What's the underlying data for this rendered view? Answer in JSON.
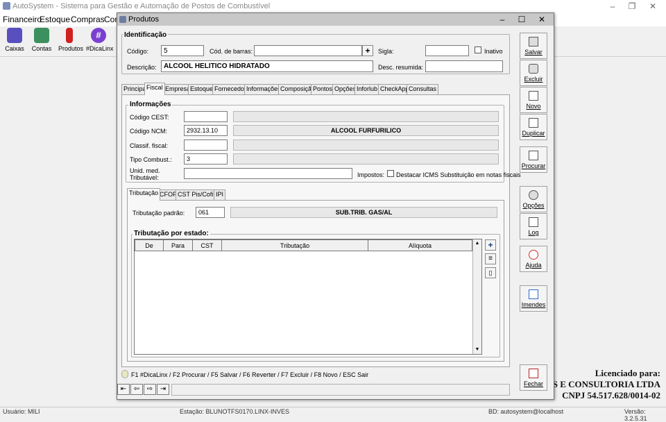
{
  "app": {
    "title": "AutoSystem - Sistema para Gestão e Automação de Postos de Combustível",
    "controls": [
      "–",
      "❐",
      "✕"
    ]
  },
  "menu": {
    "items": [
      "Financeiro",
      "Estoque",
      "Compras",
      "Con"
    ]
  },
  "toolbar": {
    "buttons": [
      {
        "label": "Caixas",
        "color": "#5a4fbf"
      },
      {
        "label": "Contas",
        "color": "#3c8f5e"
      },
      {
        "label": "Produtos",
        "color": "#d02020"
      },
      {
        "label": "#DicaLinx",
        "color": "#7a3fd0"
      }
    ]
  },
  "license": {
    "line1": "Licenciado para:",
    "line2": "MAS E CONSULTORIA LTDA",
    "line3": "CNPJ 54.517.628/0014-02"
  },
  "status": {
    "user": "Usuário: MILI",
    "station": "Estação: BLUNOTFS0170.LINX-INVES",
    "db": "BD: autosystem@localhost",
    "version": "Versão: 3.2.5.31"
  },
  "dialog": {
    "title": "Produtos",
    "controls": [
      "–",
      "☐",
      "✕"
    ],
    "identificacao": {
      "title": "Identificação",
      "codigo_label": "Código:",
      "codigo_value": "5",
      "barras_label": "Cód. de barras:",
      "barras_value": "",
      "sigla_label": "Sigla:",
      "sigla_value": "",
      "inativo_label": "Inativo",
      "descricao_label": "Descrição:",
      "descricao_value": "ALCOOL HELITICO HIDRATADO",
      "desc_resumida_label": "Desc. resumida:",
      "desc_resumida_value": ""
    },
    "tabs": [
      "Principal",
      "Fiscal",
      "Empresa",
      "Estoque",
      "Fornecedor",
      "Informações",
      "Composição",
      "Pontos",
      "Opções",
      "Inforlub",
      "CheckApp",
      "Consultas"
    ],
    "informacoes": {
      "title": "Informações",
      "cest_label": "Código CEST:",
      "cest_value": "",
      "ncm_label": "Código NCM:",
      "ncm_value": "2932.13.10",
      "ncm_desc": "ALCOOL FURFURILICO",
      "classif_label": "Classif. fiscal:",
      "classif_value": "",
      "tipo_label": "Tipo Combust.:",
      "tipo_value": "3",
      "unid_label": "Unid. med. Tributável:",
      "unid_value": "",
      "impostos_label": "Impostos:",
      "destacar_label": "Destacar ICMS Substituição em notas fiscais"
    },
    "subtabs": [
      "Tributação",
      "CFOP",
      "CST Pis/Cofins",
      "IPI"
    ],
    "tributacao": {
      "padrao_label": "Tributação padrão:",
      "padrao_value": "061",
      "padrao_desc": "SUB.TRIB. GAS/AL",
      "por_estado_title": "Tributação por estado:",
      "columns": [
        "De",
        "Para",
        "CST",
        "Tributação",
        "Alíquota"
      ]
    },
    "side_buttons": [
      {
        "label": "Salvar",
        "icon": "floppy-icon"
      },
      {
        "label": "Excluir",
        "icon": "trash-icon"
      },
      {
        "label": "Novo",
        "icon": "new-doc-icon"
      },
      {
        "label": "Duplicar",
        "icon": "duplicate-icon"
      },
      {
        "label": "Procurar",
        "icon": "search-icon"
      },
      {
        "label": "Opções",
        "icon": "gears-icon"
      },
      {
        "label": "Log",
        "icon": "log-icon"
      },
      {
        "label": "Ajuda",
        "icon": "lifebuoy-icon"
      },
      {
        "label": "Imendes",
        "icon": "imendes-icon"
      },
      {
        "label": "Fechar",
        "icon": "exit-icon"
      }
    ],
    "shortcuts": "F1 #DicaLinx / F2 Procurar / F5 Salvar / F6 Reverter / F7 Excluir / F8 Novo / ESC Sair",
    "nav": [
      "⇤",
      "⇦",
      "⇨",
      "⇥"
    ]
  }
}
